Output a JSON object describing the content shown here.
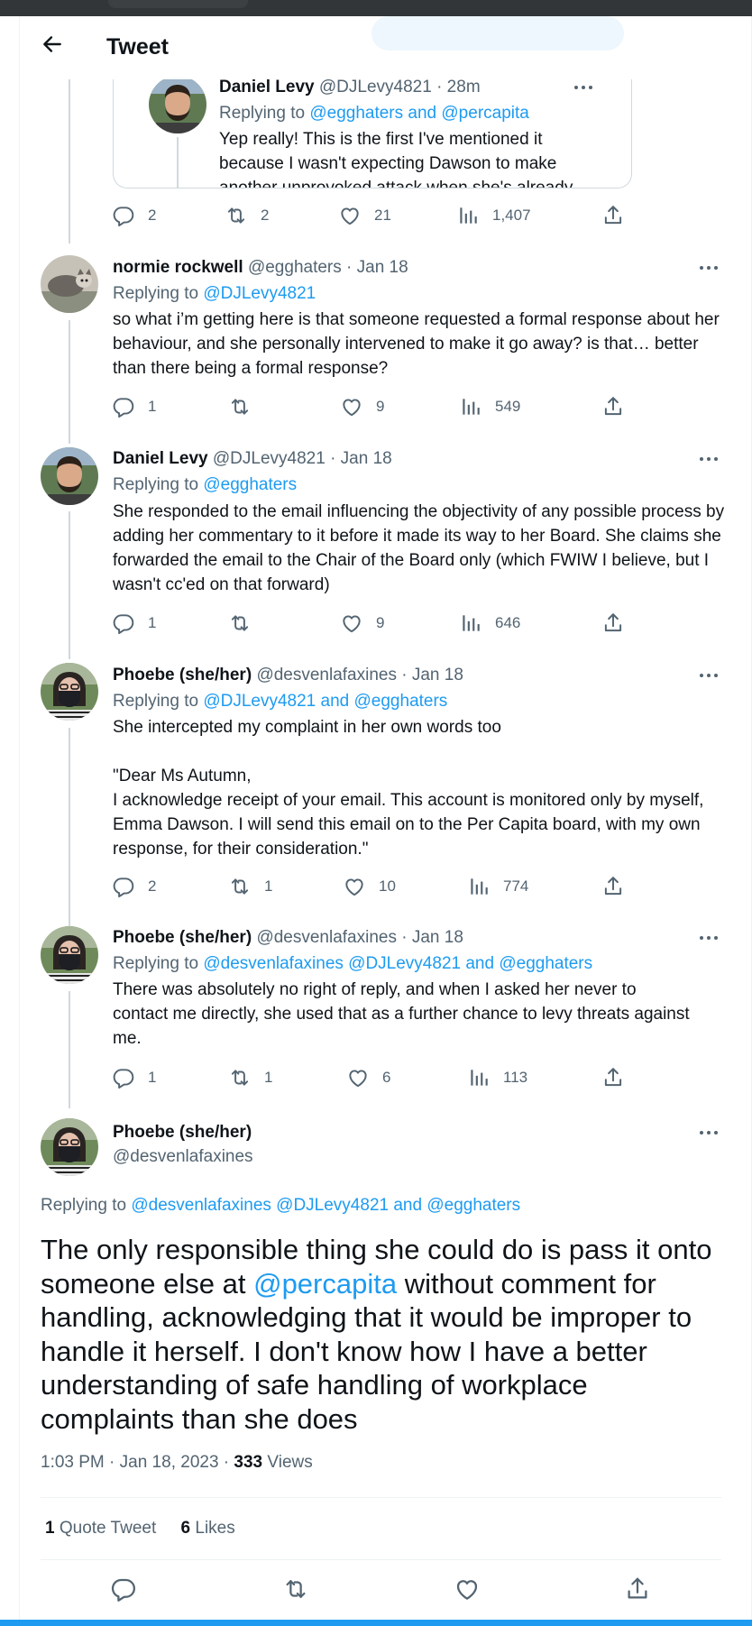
{
  "header": {
    "title": "Tweet"
  },
  "quoted": {
    "name": "Daniel Levy",
    "handle": "@DJLevy4821 · 28m",
    "replying_prefix": "Replying to",
    "replying_to": "@egghaters and @percapita",
    "text_lines": [
      "Yep really! This is the first I've mentioned it",
      "because I wasn't expecting Dawson to make",
      "another unprovoked attack when she's already"
    ],
    "stats": {
      "replies": "2",
      "retweets": "2",
      "likes": "21",
      "views": "1,407"
    }
  },
  "tweets": [
    {
      "name": "normie rockwell",
      "handle": "@egghaters · Jan 18",
      "replying_prefix": "Replying to",
      "replying_to": "@DJLevy4821",
      "text": "so what i’m getting here is that someone requested a formal response about her behaviour, and she personally intervened to make it go away? is that… better than there being a formal response?",
      "stats": {
        "replies": "1",
        "retweets": "",
        "likes": "9",
        "views": "549"
      }
    },
    {
      "name": "Daniel Levy",
      "handle": "@DJLevy4821 · Jan 18",
      "replying_prefix": "Replying to",
      "replying_to": "@egghaters",
      "text": "She responded to the email influencing the objectivity of any possible process by adding her commentary to it before it made its way to her Board. She claims she forwarded the email to the Chair of the Board only (which FWIW I believe, but I wasn't cc'ed on that forward)",
      "stats": {
        "replies": "1",
        "retweets": "",
        "likes": "9",
        "views": "646"
      }
    },
    {
      "name": "Phoebe (she/her)",
      "handle": "@desvenlafaxines · Jan 18",
      "replying_prefix": "Replying to",
      "replying_to": "@DJLevy4821 and @egghaters",
      "text": "She intercepted my complaint in her own words too\n\n\"Dear Ms Autumn,\nI acknowledge receipt of your email. This account is monitored only by myself, Emma Dawson. I will send this email on to the Per Capita board, with my own response, for their consideration.\"",
      "stats": {
        "replies": "2",
        "retweets": "1",
        "likes": "10",
        "views": "774"
      }
    },
    {
      "name": "Phoebe (she/her)",
      "handle": "@desvenlafaxines · Jan 18",
      "replying_prefix": "Replying to",
      "replying_to": "@desvenlafaxines @DJLevy4821 and @egghaters",
      "text": "There was absolutely no right of reply, and when I asked her never to contact me directly, she used that as a further chance to levy threats against me.",
      "stats": {
        "replies": "1",
        "retweets": "1",
        "likes": "6",
        "views": "113"
      }
    }
  ],
  "main_tweet": {
    "name": "Phoebe (she/her)",
    "handle": "@desvenlafaxines",
    "replying_prefix": "Replying to",
    "replying_to": "@desvenlafaxines @DJLevy4821 and @egghaters",
    "text_before": "The only responsible thing she could do is pass it onto someone else at ",
    "mention": "@percapita",
    "text_after": " without comment for handling, acknowledging that it would be improper to handle it herself. I don't know how I have a better understanding of safe handling of workplace complaints than she does",
    "timestamp": "1:03 PM · Jan 18, 2023 · ",
    "views_count": "333",
    "views_label": " Views",
    "quote_count": "1",
    "quote_label": " Quote Tweet",
    "likes_count": "6",
    "likes_label": " Likes"
  },
  "colors": {
    "accent": "#1d9bf0",
    "muted": "#536471",
    "text": "#0f1419",
    "border": "#eff3f4"
  },
  "icons": [
    "back-arrow-icon",
    "more-icon",
    "reply-icon",
    "retweet-icon",
    "like-icon",
    "views-icon",
    "share-icon"
  ]
}
